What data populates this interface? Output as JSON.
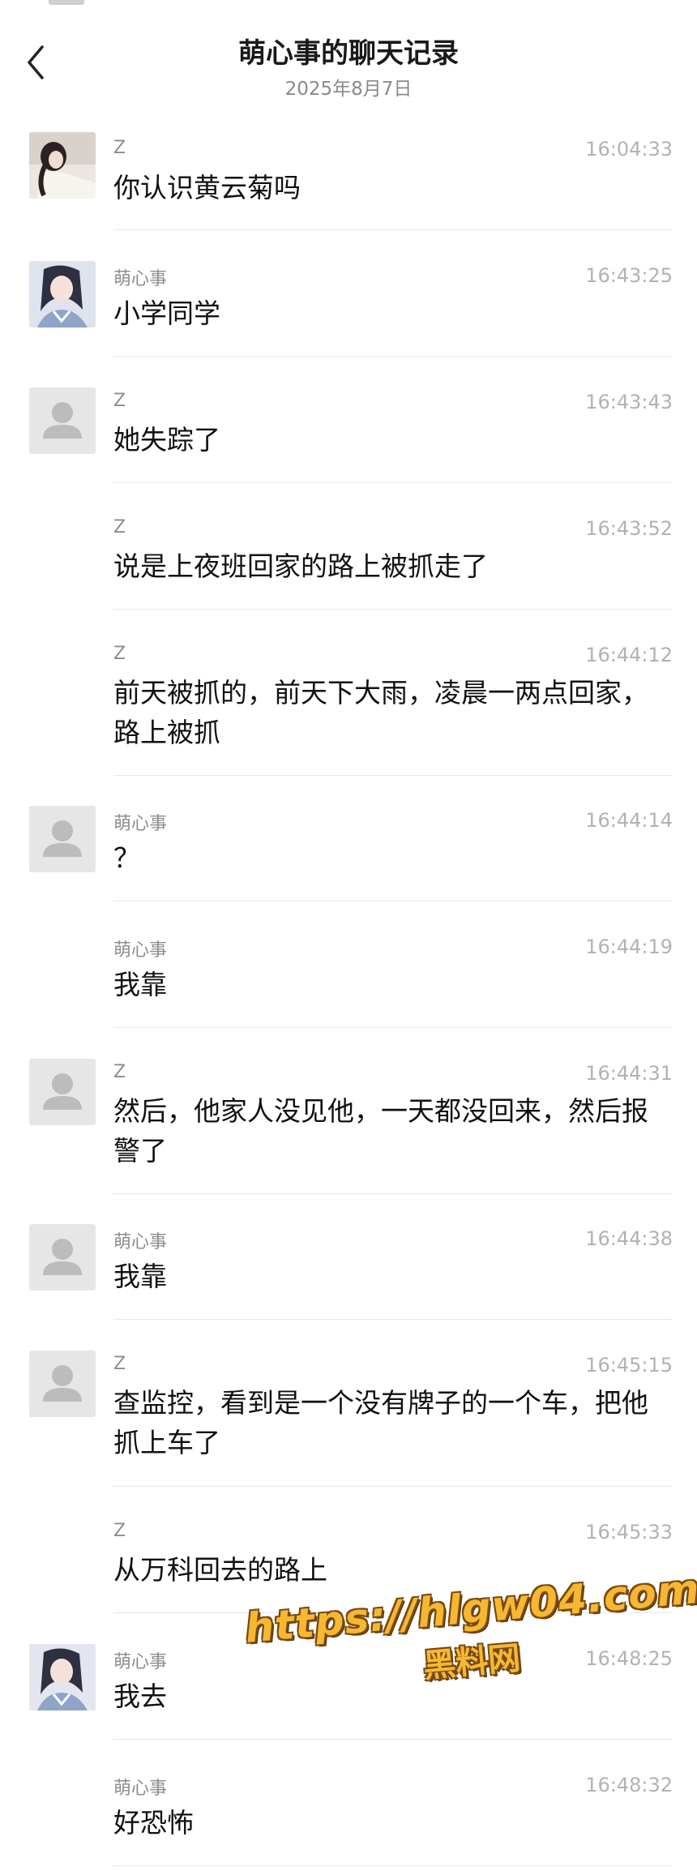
{
  "header": {
    "title": "萌心事的聊天记录",
    "date": "2025年8月7日"
  },
  "messages": [
    {
      "name": "Z",
      "time": "16:04:33",
      "text": "你认识黄云菊吗",
      "avatar": "photo-woman"
    },
    {
      "name": "萌心事",
      "time": "16:43:25",
      "text": "小学同学",
      "avatar": "photo-anime-girl"
    },
    {
      "name": "Z",
      "time": "16:43:43",
      "text": "她失踪了",
      "avatar": "default-user"
    },
    {
      "name": "Z",
      "time": "16:43:52",
      "text": "说是上夜班回家的路上被抓走了",
      "avatar": "none"
    },
    {
      "name": "Z",
      "time": "16:44:12",
      "text": "前天被抓的，前天下大雨，凌晨一两点回家，路上被抓",
      "avatar": "none"
    },
    {
      "name": "萌心事",
      "time": "16:44:14",
      "text": "？",
      "avatar": "default-user"
    },
    {
      "name": "萌心事",
      "time": "16:44:19",
      "text": "我靠",
      "avatar": "none"
    },
    {
      "name": "Z",
      "time": "16:44:31",
      "text": "然后，他家人没见他，一天都没回来，然后报警了",
      "avatar": "default-user"
    },
    {
      "name": "萌心事",
      "time": "16:44:38",
      "text": "我靠",
      "avatar": "default-user"
    },
    {
      "name": "Z",
      "time": "16:45:15",
      "text": "查监控，看到是一个没有牌子的一个车，把他抓上车了",
      "avatar": "default-user"
    },
    {
      "name": "Z",
      "time": "16:45:33",
      "text": "从万科回去的路上",
      "avatar": "none"
    },
    {
      "name": "萌心事",
      "time": "16:48:25",
      "text": "我去",
      "avatar": "photo-anime-girl"
    },
    {
      "name": "萌心事",
      "time": "16:48:32",
      "text": "好恐怖",
      "avatar": "none"
    }
  ],
  "watermark": {
    "url": "https://hlgw04.com",
    "label": "黑料网"
  },
  "colors": {
    "title": "#1a1a1a",
    "meta": "#8d8d8d",
    "time": "#b2b2b2",
    "watermark_fill": "#f6b833",
    "watermark_outline": "#7a4a10"
  }
}
